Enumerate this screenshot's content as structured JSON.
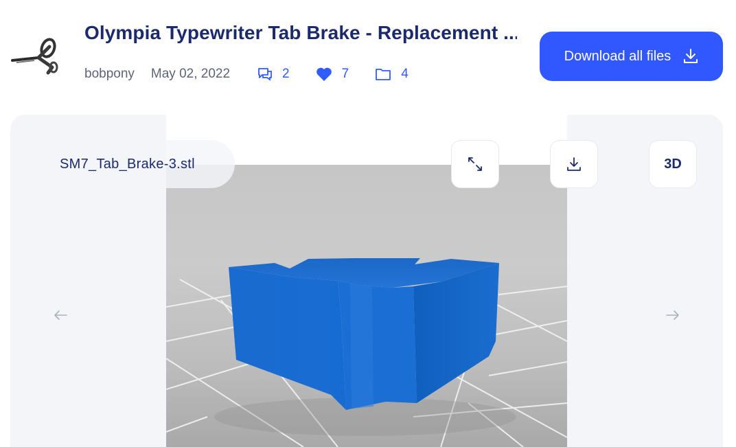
{
  "header": {
    "title": "Olympia Typewriter Tab Brake - Replacement ...",
    "author": "bobpony",
    "date": "May 02, 2022",
    "comments_count": "2",
    "likes_count": "7",
    "collections_count": "4",
    "download_all_label": "Download all files",
    "thumbnail_icon": "typewriter-key-thumbnail"
  },
  "viewer": {
    "filename": "SM7_Tab_Brake-3.stl",
    "three_d_label": "3D",
    "icons": {
      "expand": "expand-icon",
      "download": "download-icon",
      "prev": "arrow-left-icon",
      "next": "arrow-right-icon"
    }
  },
  "colors": {
    "accent": "#3158ff",
    "title": "#1a2a6c",
    "model_blue": "#1f6fd1",
    "viewer_bg": "#f3f5f9"
  }
}
